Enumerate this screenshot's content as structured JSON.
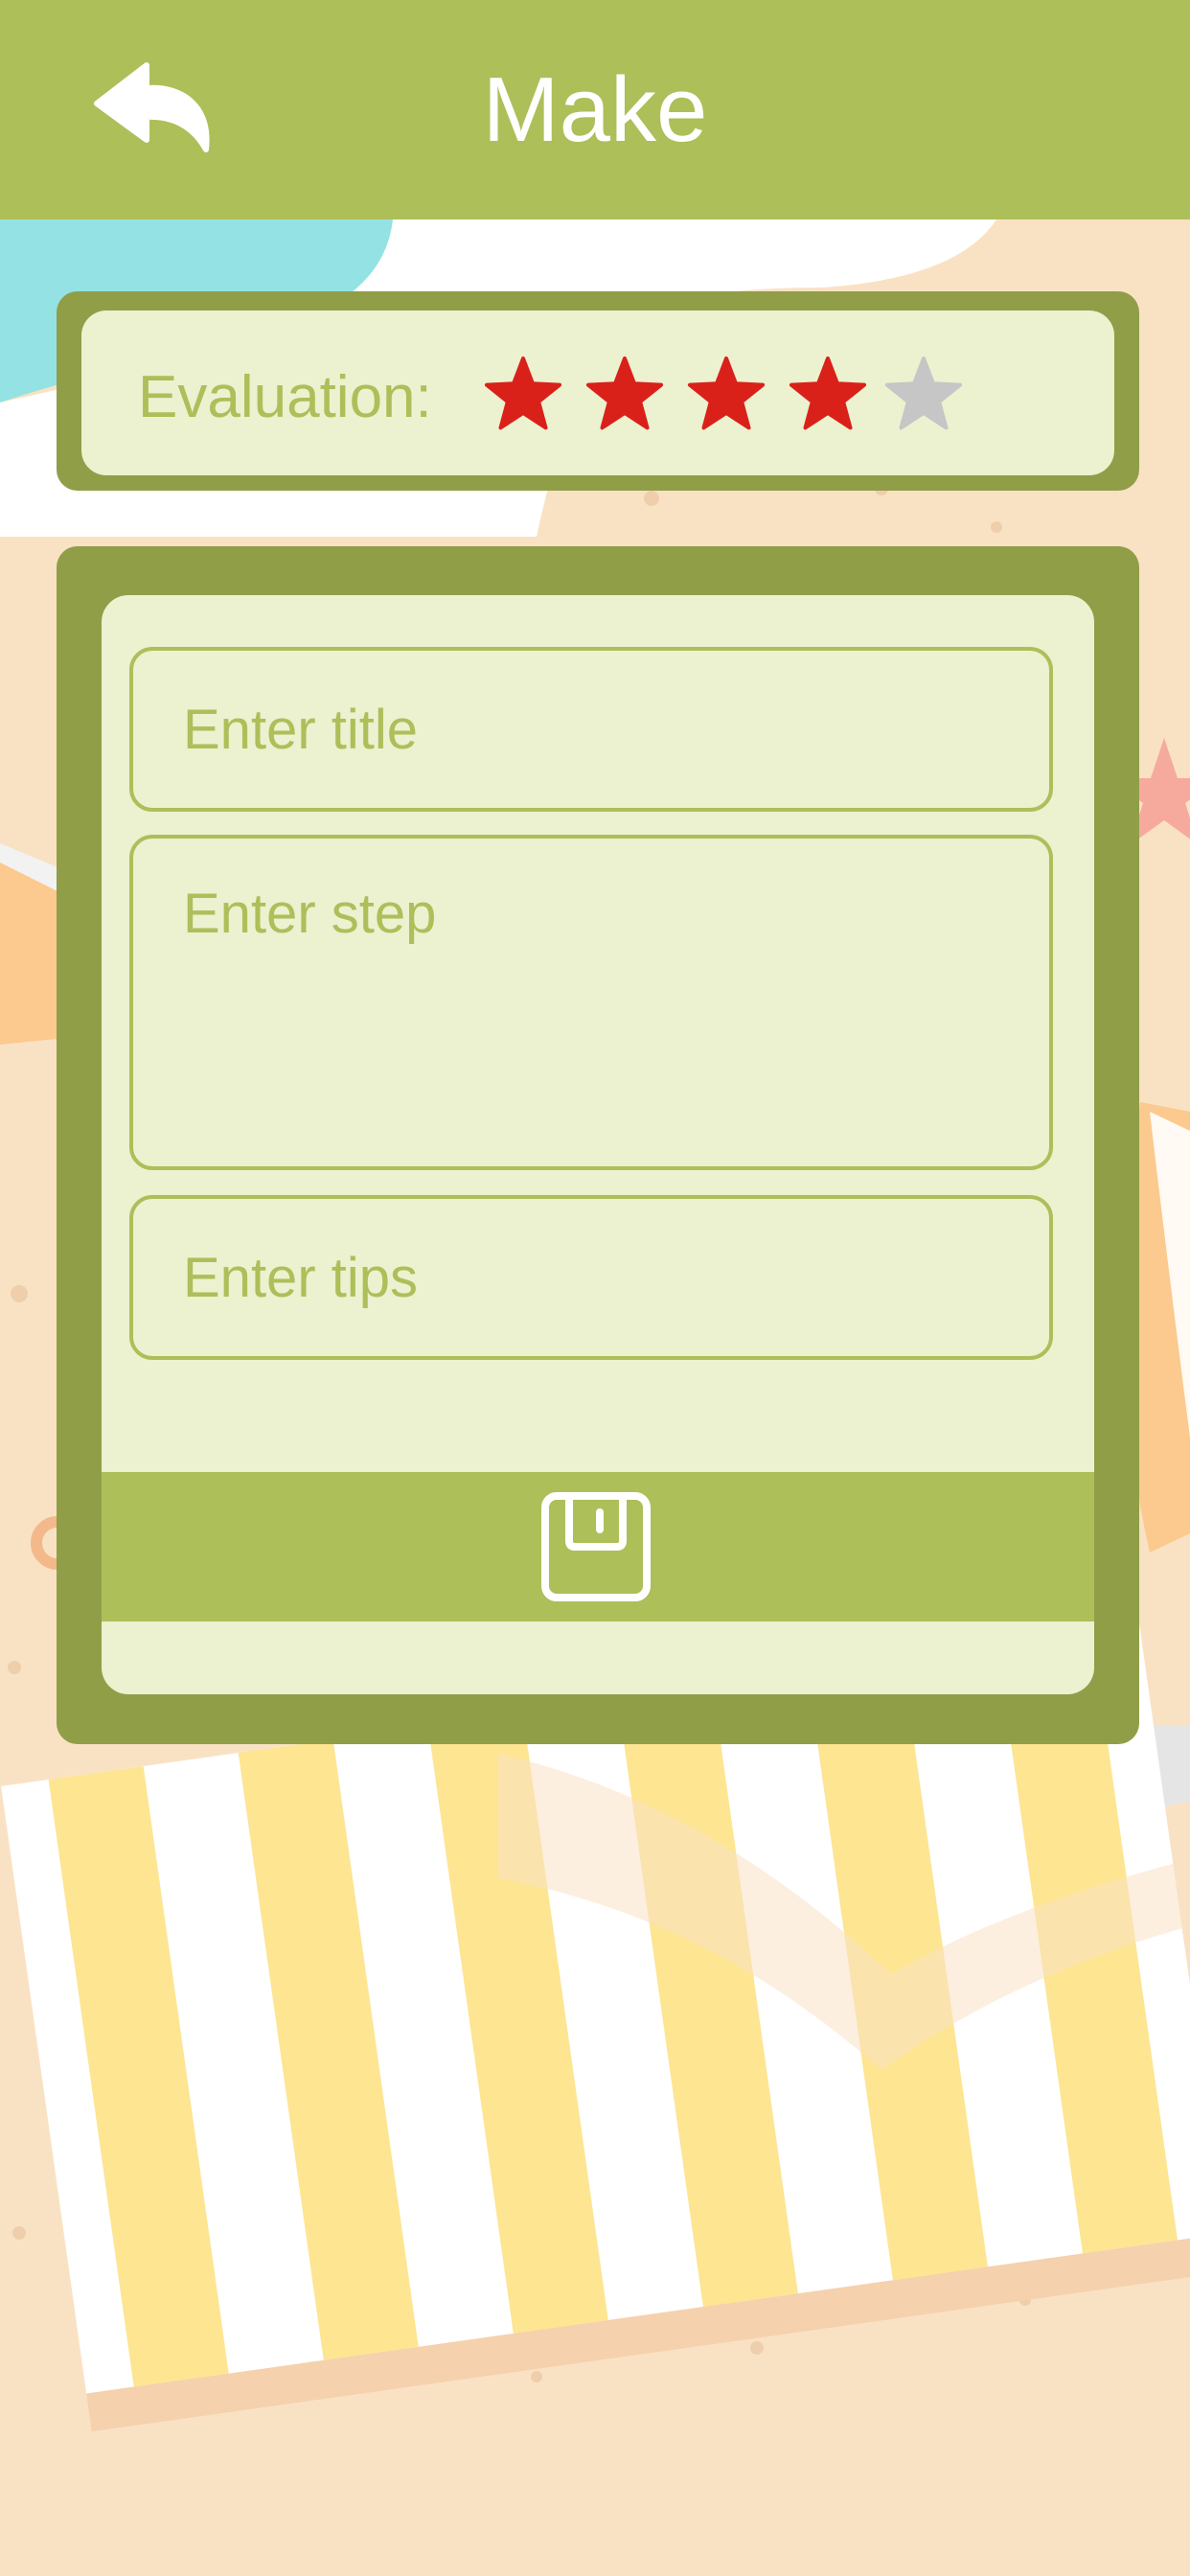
{
  "header": {
    "title": "Make",
    "back_icon": "back-arrow-icon"
  },
  "evaluation": {
    "label": "Evaluation:",
    "rating": 4,
    "max": 5,
    "filled_color": "#d9211a",
    "empty_color": "#c6c6c6"
  },
  "form": {
    "title_placeholder": "Enter title",
    "step_placeholder": "Enter step",
    "tips_placeholder": "Enter tips",
    "save_icon": "floppy-disk-icon"
  },
  "colors": {
    "header_bg": "#adbf59",
    "card_border": "#909e48",
    "card_fill": "#ecf1d0",
    "text_accent": "#adbf59",
    "background": "#f9e2c4"
  }
}
